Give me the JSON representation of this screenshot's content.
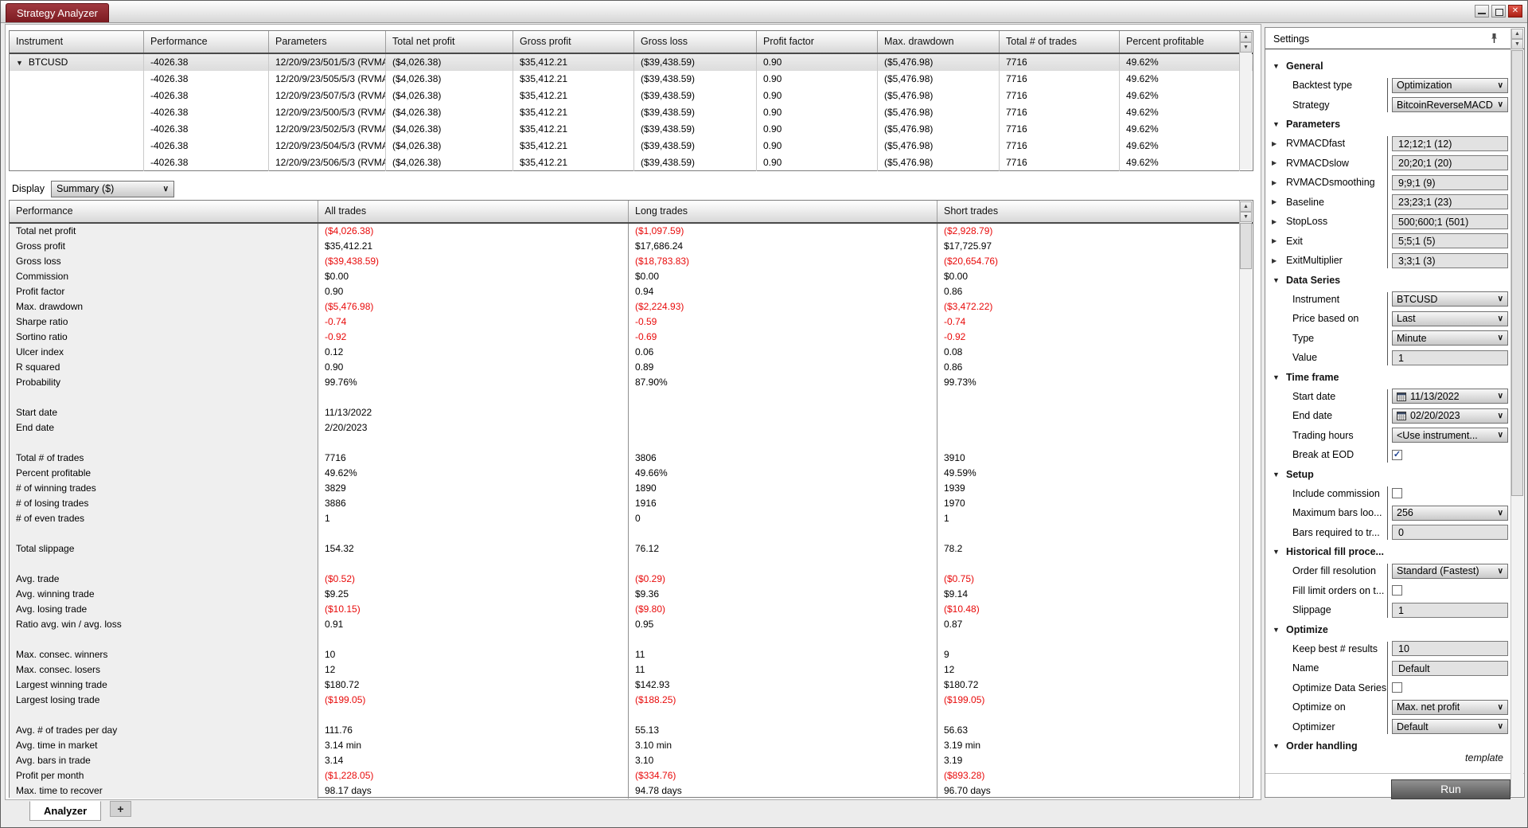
{
  "window": {
    "tab_title": "Strategy Analyzer",
    "window_controls": [
      "minimize",
      "restore",
      "close"
    ]
  },
  "results_grid": {
    "columns": [
      "Instrument",
      "Performance",
      "Parameters",
      "Total net profit",
      "Gross profit",
      "Gross loss",
      "Profit factor",
      "Max. drawdown",
      "Total # of trades",
      "Percent profitable"
    ],
    "rows": [
      {
        "selected": true,
        "instrument": "BTCUSD",
        "performance": "-4026.38",
        "parameters": "12/20/9/23/501/5/3 (RVMA",
        "total_net_profit": "($4,026.38)",
        "gross_profit": "$35,412.21",
        "gross_loss": "($39,438.59)",
        "profit_factor": "0.90",
        "max_drawdown": "($5,476.98)",
        "total_trades": "7716",
        "percent_profitable": "49.62%"
      },
      {
        "selected": false,
        "instrument": "",
        "performance": "-4026.38",
        "parameters": "12/20/9/23/505/5/3 (RVMA",
        "total_net_profit": "($4,026.38)",
        "gross_profit": "$35,412.21",
        "gross_loss": "($39,438.59)",
        "profit_factor": "0.90",
        "max_drawdown": "($5,476.98)",
        "total_trades": "7716",
        "percent_profitable": "49.62%"
      },
      {
        "selected": false,
        "instrument": "",
        "performance": "-4026.38",
        "parameters": "12/20/9/23/507/5/3 (RVMA",
        "total_net_profit": "($4,026.38)",
        "gross_profit": "$35,412.21",
        "gross_loss": "($39,438.59)",
        "profit_factor": "0.90",
        "max_drawdown": "($5,476.98)",
        "total_trades": "7716",
        "percent_profitable": "49.62%"
      },
      {
        "selected": false,
        "instrument": "",
        "performance": "-4026.38",
        "parameters": "12/20/9/23/500/5/3 (RVMA",
        "total_net_profit": "($4,026.38)",
        "gross_profit": "$35,412.21",
        "gross_loss": "($39,438.59)",
        "profit_factor": "0.90",
        "max_drawdown": "($5,476.98)",
        "total_trades": "7716",
        "percent_profitable": "49.62%"
      },
      {
        "selected": false,
        "instrument": "",
        "performance": "-4026.38",
        "parameters": "12/20/9/23/502/5/3 (RVMA",
        "total_net_profit": "($4,026.38)",
        "gross_profit": "$35,412.21",
        "gross_loss": "($39,438.59)",
        "profit_factor": "0.90",
        "max_drawdown": "($5,476.98)",
        "total_trades": "7716",
        "percent_profitable": "49.62%"
      },
      {
        "selected": false,
        "instrument": "",
        "performance": "-4026.38",
        "parameters": "12/20/9/23/504/5/3 (RVMA",
        "total_net_profit": "($4,026.38)",
        "gross_profit": "$35,412.21",
        "gross_loss": "($39,438.59)",
        "profit_factor": "0.90",
        "max_drawdown": "($5,476.98)",
        "total_trades": "7716",
        "percent_profitable": "49.62%"
      },
      {
        "selected": false,
        "instrument": "",
        "performance": "-4026.38",
        "parameters": "12/20/9/23/506/5/3 (RVMA",
        "total_net_profit": "($4,026.38)",
        "gross_profit": "$35,412.21",
        "gross_loss": "($39,438.59)",
        "profit_factor": "0.90",
        "max_drawdown": "($5,476.98)",
        "total_trades": "7716",
        "percent_profitable": "49.62%"
      }
    ]
  },
  "display": {
    "label": "Display",
    "value": "Summary ($)"
  },
  "performance_grid": {
    "columns": [
      "Performance",
      "All trades",
      "Long trades",
      "Short trades"
    ],
    "rows": [
      [
        "Total net profit",
        "($4,026.38)",
        "($1,097.59)",
        "($2,928.79)"
      ],
      [
        "Gross profit",
        "$35,412.21",
        "$17,686.24",
        "$17,725.97"
      ],
      [
        "Gross loss",
        "($39,438.59)",
        "($18,783.83)",
        "($20,654.76)"
      ],
      [
        "Commission",
        "$0.00",
        "$0.00",
        "$0.00"
      ],
      [
        "Profit factor",
        "0.90",
        "0.94",
        "0.86"
      ],
      [
        "Max. drawdown",
        "($5,476.98)",
        "($2,224.93)",
        "($3,472.22)"
      ],
      [
        "Sharpe ratio",
        "-0.74",
        "-0.59",
        "-0.74"
      ],
      [
        "Sortino ratio",
        "-0.92",
        "-0.69",
        "-0.92"
      ],
      [
        "Ulcer index",
        "0.12",
        "0.06",
        "0.08"
      ],
      [
        "R squared",
        "0.90",
        "0.89",
        "0.86"
      ],
      [
        "Probability",
        "99.76%",
        "87.90%",
        "99.73%"
      ],
      null,
      [
        "Start date",
        "11/13/2022",
        "",
        ""
      ],
      [
        "End date",
        "2/20/2023",
        "",
        ""
      ],
      null,
      [
        "Total # of trades",
        "7716",
        "3806",
        "3910"
      ],
      [
        "Percent profitable",
        "49.62%",
        "49.66%",
        "49.59%"
      ],
      [
        "# of winning trades",
        "3829",
        "1890",
        "1939"
      ],
      [
        "# of losing trades",
        "3886",
        "1916",
        "1970"
      ],
      [
        "# of even trades",
        "1",
        "0",
        "1"
      ],
      null,
      [
        "Total slippage",
        "154.32",
        "76.12",
        "78.2"
      ],
      null,
      [
        "Avg. trade",
        "($0.52)",
        "($0.29)",
        "($0.75)"
      ],
      [
        "Avg. winning trade",
        "$9.25",
        "$9.36",
        "$9.14"
      ],
      [
        "Avg. losing trade",
        "($10.15)",
        "($9.80)",
        "($10.48)"
      ],
      [
        "Ratio avg. win / avg. loss",
        "0.91",
        "0.95",
        "0.87"
      ],
      null,
      [
        "Max. consec. winners",
        "10",
        "11",
        "9"
      ],
      [
        "Max. consec. losers",
        "12",
        "11",
        "12"
      ],
      [
        "Largest winning trade",
        "$180.72",
        "$142.93",
        "$180.72"
      ],
      [
        "Largest losing trade",
        "($199.05)",
        "($188.25)",
        "($199.05)"
      ],
      null,
      [
        "Avg. # of trades per day",
        "111.76",
        "55.13",
        "56.63"
      ],
      [
        "Avg. time in market",
        "3.14 min",
        "3.10 min",
        "3.19 min"
      ],
      [
        "Avg. bars in trade",
        "3.14",
        "3.10",
        "3.19"
      ],
      [
        "Profit per month",
        "($1,228.05)",
        "($334.76)",
        "($893.28)"
      ],
      [
        "Max. time to recover",
        "98.17 days",
        "94.78 days",
        "96.70 days"
      ]
    ]
  },
  "tabs": {
    "analyzer": "Analyzer",
    "add": "+"
  },
  "settings": {
    "title": "Settings",
    "sections": [
      {
        "label": "General",
        "rows": [
          {
            "label": "Backtest type",
            "control": "select",
            "value": "Optimization"
          },
          {
            "label": "Strategy",
            "control": "select",
            "value": "BitcoinReverseMACD"
          }
        ]
      },
      {
        "label": "Parameters",
        "rows": [
          {
            "label": "RVMACDfast",
            "control": "textbox",
            "value": "12;12;1 (12)",
            "expander": true
          },
          {
            "label": "RVMACDslow",
            "control": "textbox",
            "value": "20;20;1 (20)",
            "expander": true
          },
          {
            "label": "RVMACDsmoothing",
            "control": "textbox",
            "value": "9;9;1 (9)",
            "expander": true
          },
          {
            "label": "Baseline",
            "control": "textbox",
            "value": "23;23;1 (23)",
            "expander": true
          },
          {
            "label": "StopLoss",
            "control": "textbox",
            "value": "500;600;1 (501)",
            "expander": true
          },
          {
            "label": "Exit",
            "control": "textbox",
            "value": "5;5;1 (5)",
            "expander": true
          },
          {
            "label": "ExitMultiplier",
            "control": "textbox",
            "value": "3;3;1 (3)",
            "expander": true
          }
        ]
      },
      {
        "label": "Data Series",
        "rows": [
          {
            "label": "Instrument",
            "control": "select",
            "value": "BTCUSD"
          },
          {
            "label": "Price based on",
            "control": "select",
            "value": "Last"
          },
          {
            "label": "Type",
            "control": "select",
            "value": "Minute"
          },
          {
            "label": "Value",
            "control": "textbox",
            "value": "1"
          }
        ]
      },
      {
        "label": "Time frame",
        "rows": [
          {
            "label": "Start date",
            "control": "date",
            "value": "11/13/2022"
          },
          {
            "label": "End date",
            "control": "date",
            "value": "02/20/2023"
          },
          {
            "label": "Trading hours",
            "control": "select",
            "value": "<Use instrument..."
          },
          {
            "label": "Break at EOD",
            "control": "checkbox",
            "checked": true
          }
        ]
      },
      {
        "label": "Setup",
        "rows": [
          {
            "label": "Include commission",
            "control": "checkbox",
            "checked": false
          },
          {
            "label": "Maximum bars loo...",
            "control": "select",
            "value": "256"
          },
          {
            "label": "Bars required to tr...",
            "control": "textbox",
            "value": "0"
          }
        ]
      },
      {
        "label": "Historical fill proce...",
        "rows": [
          {
            "label": "Order fill resolution",
            "control": "select",
            "value": "Standard (Fastest)"
          },
          {
            "label": "Fill limit orders on t...",
            "control": "checkbox",
            "checked": false
          },
          {
            "label": "Slippage",
            "control": "textbox",
            "value": "1"
          }
        ]
      },
      {
        "label": "Optimize",
        "rows": [
          {
            "label": "Keep best # results",
            "control": "textbox",
            "value": "10"
          },
          {
            "label": "Name",
            "control": "textbox",
            "value": "Default"
          },
          {
            "label": "Optimize Data Series",
            "control": "checkbox",
            "checked": false
          },
          {
            "label": "Optimize on",
            "control": "select",
            "value": "Max. net profit"
          },
          {
            "label": "Optimizer",
            "control": "select",
            "value": "Default"
          }
        ]
      },
      {
        "label": "Order handling",
        "rows": []
      }
    ],
    "template_link": "template",
    "run_label": "Run"
  }
}
